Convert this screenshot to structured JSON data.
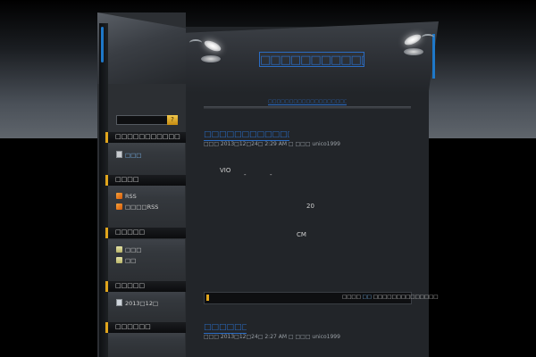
{
  "site": {
    "title": "□□□□□□□□□□□□□□",
    "tagline": "□□□□□□□□□□□□□□□□□□□□□□□□□□"
  },
  "search": {
    "button_label": "?"
  },
  "sidebar": {
    "widgets": [
      {
        "title": "□□□□□□□□□□□",
        "items": [
          {
            "icon": "page-icon",
            "label": "□□□",
            "link": true
          }
        ]
      },
      {
        "title": "□□□□",
        "items": [
          {
            "icon": "rss-icon",
            "label": "RSS"
          },
          {
            "icon": "rss-icon",
            "label": "□□□□RSS"
          }
        ]
      },
      {
        "title": "□□□□□",
        "items": [
          {
            "icon": "folder-icon",
            "label": "□□□"
          },
          {
            "icon": "folder-icon",
            "label": "□□"
          }
        ]
      },
      {
        "title": "□□□□□",
        "items": [
          {
            "icon": "calendar-icon",
            "label": "2013□12□"
          }
        ]
      },
      {
        "title": "□□□□□□",
        "items": []
      }
    ]
  },
  "posts": [
    {
      "title": "□□□□□□□□□□□□□□□□",
      "meta": "□□□ 2013□12□24□ 2:29 AM □ □□□ unico1999",
      "body": [
        "VIO",
        "-",
        "-",
        "20",
        "CM"
      ]
    },
    {
      "title": "□□□□□□□□",
      "meta": "□□□ 2013□12□24□ 2:27 AM □ □□□ unico1999"
    }
  ],
  "nav": {
    "before": "□□□□",
    "link": "□□",
    "after": "□□□□□□□□□□□□□□"
  },
  "colors": {
    "accent_blue": "#2a6cc4",
    "accent_gold": "#e0a51c",
    "panel": "#222529"
  }
}
